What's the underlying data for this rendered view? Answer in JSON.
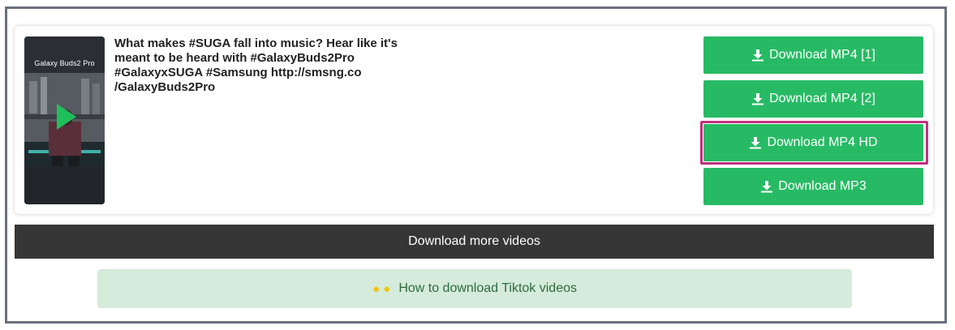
{
  "video": {
    "thumbnail_label": "Galaxy Buds2 Pro",
    "description": "What makes #SUGA fall into music? Hear like it's\nmeant to be heard with #GalaxyBuds2Pro\n#GalaxyxSUGA #Samsung http://smsng.co\n/GalaxyBuds2Pro"
  },
  "downloads": [
    {
      "label": "Download MP4 [1]",
      "icon": "download-icon"
    },
    {
      "label": "Download MP4 [2]",
      "icon": "download-icon"
    },
    {
      "label": "Download MP4 HD",
      "icon": "download-icon",
      "highlighted": true
    },
    {
      "label": "Download MP3",
      "icon": "download-icon"
    }
  ],
  "more_videos_label": "Download more videos",
  "howto": {
    "label": "How to download Tiktok videos",
    "icon": "lightbulb-icon"
  },
  "colors": {
    "button_green": "#27ba64",
    "highlight_magenta": "#c0307f",
    "dark_bar": "#363636",
    "howto_bg": "#d5ebdb",
    "howto_text": "#2d6b3d"
  }
}
